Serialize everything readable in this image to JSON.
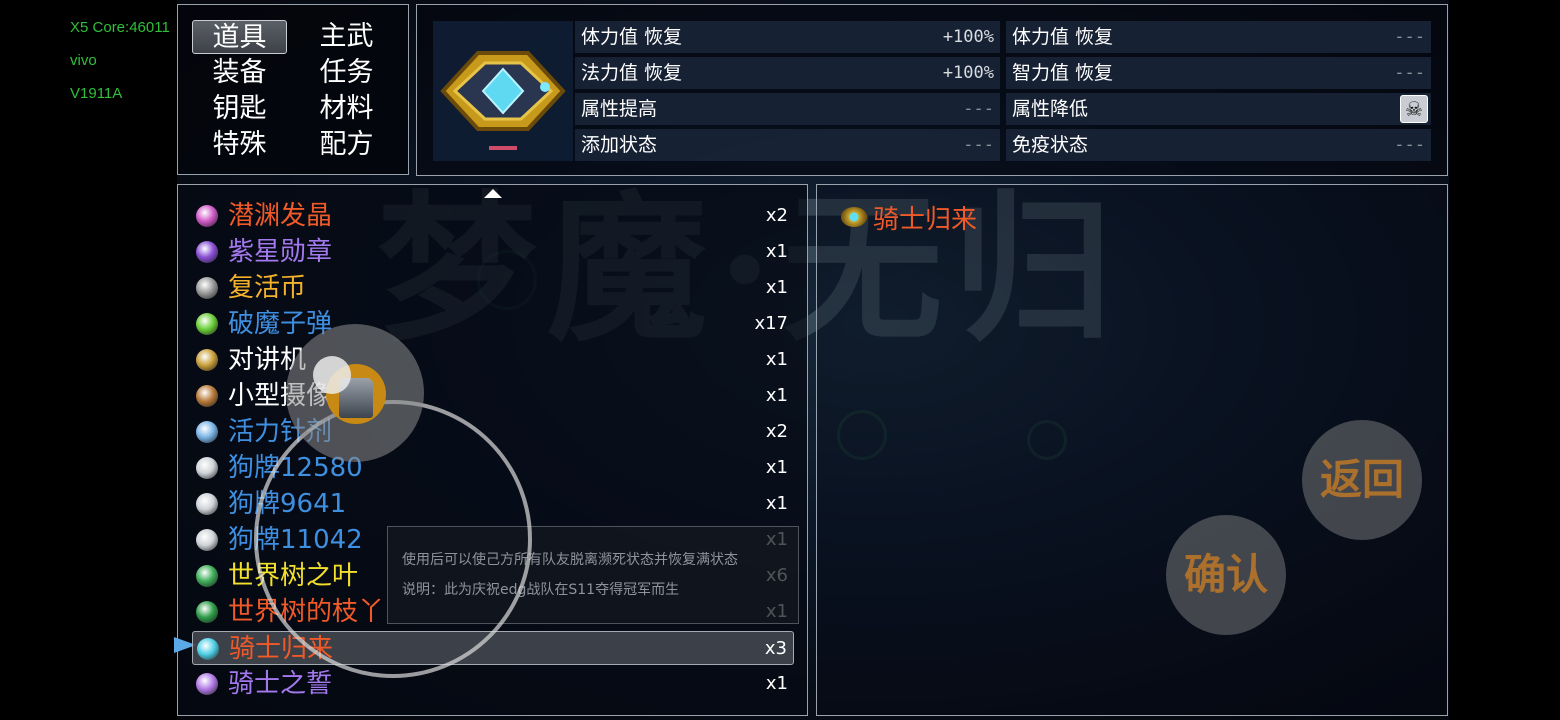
{
  "debug": {
    "line1": "X5 Core:46011",
    "line2": "vivo",
    "line3": "V1911A"
  },
  "categories": [
    {
      "label": "道具",
      "selected": true
    },
    {
      "label": "主武"
    },
    {
      "label": "装备"
    },
    {
      "label": "任务"
    },
    {
      "label": "钥匙"
    },
    {
      "label": "材料"
    },
    {
      "label": "特殊"
    },
    {
      "label": "配方"
    }
  ],
  "stats": [
    {
      "label": "体力值 恢复",
      "value": "+100%"
    },
    {
      "label": "体力值 恢复",
      "value": "---"
    },
    {
      "label": "法力值 恢复",
      "value": "+100%"
    },
    {
      "label": "智力值 恢复",
      "value": "---"
    },
    {
      "label": "属性提高",
      "value": "---"
    },
    {
      "label": "属性降低",
      "value": "",
      "icon": "skull-icon"
    },
    {
      "label": "添加状态",
      "value": "---"
    },
    {
      "label": "免疫状态",
      "value": "---"
    }
  ],
  "items": [
    {
      "name": "潜渊发晶",
      "qty": "x2",
      "color": "#f05a28",
      "icon": "crystal-icon",
      "icon_color": "#d05ac8"
    },
    {
      "name": "紫星勋章",
      "qty": "x1",
      "color": "#a479ee",
      "icon": "purple-medal-icon",
      "icon_color": "#8a4fd6"
    },
    {
      "name": "复活币",
      "qty": "x1",
      "color": "#f3b12c",
      "icon": "coin-icon",
      "icon_color": "#9a9a9a"
    },
    {
      "name": "破魔子弹",
      "qty": "x17",
      "color": "#3f8fe0",
      "icon": "bullet-icon",
      "icon_color": "#6bcf3a"
    },
    {
      "name": "对讲机",
      "qty": "x1",
      "color": "#ffffff",
      "icon": "walkie-talkie-icon",
      "icon_color": "#c9a03a"
    },
    {
      "name": "小型摄像机",
      "qty": "x1",
      "color": "#ffffff",
      "icon": "camera-icon",
      "icon_color": "#b87a3a"
    },
    {
      "name": "活力针剂",
      "qty": "x2",
      "color": "#3f8fe0",
      "icon": "syringe-icon",
      "icon_color": "#7ab4e6"
    },
    {
      "name": "狗牌12580",
      "qty": "x1",
      "color": "#3f8fe0",
      "icon": "dog-tag-icon",
      "icon_color": "#cfd3d8"
    },
    {
      "name": "狗牌9641",
      "qty": "x1",
      "color": "#3f8fe0",
      "icon": "dog-tag-icon",
      "icon_color": "#cfd3d8"
    },
    {
      "name": "狗牌11042",
      "qty": "x1",
      "color": "#3f8fe0",
      "icon": "dog-tag-icon",
      "icon_color": "#cfd3d8"
    },
    {
      "name": "世界树之叶",
      "qty": "x6",
      "color": "#f3e02c",
      "icon": "leaf-icon",
      "icon_color": "#3fae5a"
    },
    {
      "name": "世界树的枝丫",
      "qty": "x1",
      "color": "#f05a28",
      "icon": "clover-icon",
      "icon_color": "#2f9e4a"
    },
    {
      "name": "骑士归来",
      "qty": "x3",
      "color": "#f05a28",
      "icon": "knight-gem-icon",
      "icon_color": "#4fd0e6",
      "selected": true
    },
    {
      "name": "骑士之誓",
      "qty": "x1",
      "color": "#a479ee",
      "icon": "orb-icon",
      "icon_color": "#b07ae6"
    }
  ],
  "description": {
    "line1": "使用后可以使己方所有队友脱离濒死状态并恢复满状态",
    "line2": "说明：此为庆祝edg战队在S11夺得冠军而生"
  },
  "detail": {
    "title": "骑士归来",
    "icon": "knight-gem-icon"
  },
  "buttons": {
    "back": "返回",
    "confirm": "确认"
  },
  "background_logo": "梦魔·无归"
}
